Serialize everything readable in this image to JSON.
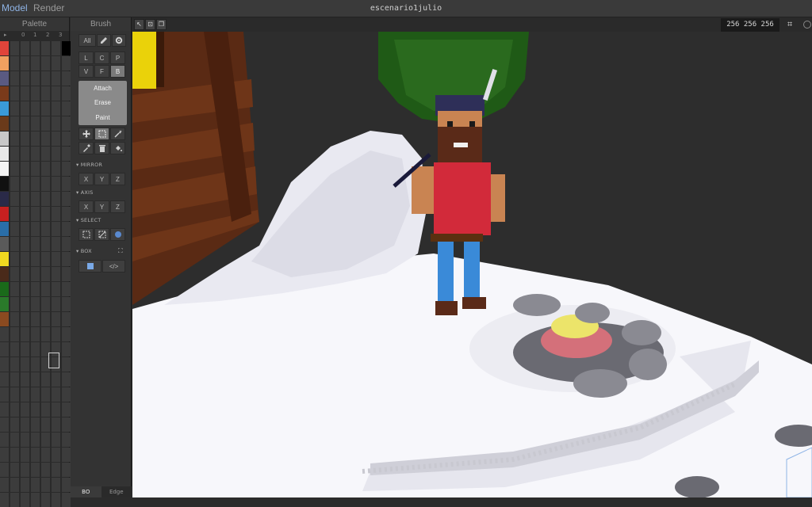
{
  "header": {
    "tabs": [
      {
        "label": "Model"
      },
      {
        "label": "Render"
      }
    ],
    "file_title": "escenario1julio"
  },
  "palette": {
    "title": "Palette",
    "columns": [
      "0",
      "1",
      "2",
      "3"
    ],
    "colors": [
      "#e0443a",
      "#f0a060",
      "#5a5a82",
      "#7a3a1a",
      "#3a9ad8",
      "#6a3a1a",
      "#c8c8c8",
      "#e8e8e8",
      "#f4f4f4",
      "#111111",
      "#2a2a48",
      "#c82020",
      "#2a6ea8",
      "#5a5a5a",
      "#f0d820",
      "#4a2a1a",
      "#1a6a1a",
      "#2a7a2a",
      "#8a4a20"
    ]
  },
  "brush": {
    "title": "Brush",
    "all_label": "All",
    "row1": [
      "L",
      "C",
      "P"
    ],
    "row2": [
      "V",
      "F",
      "B"
    ],
    "modes": [
      "Attach",
      "Erase",
      "Paint"
    ],
    "mirror_label": "MIRROR",
    "axis_label": "AXIS",
    "select_label": "SELECT",
    "box_label": "BOX",
    "xyz": [
      "X",
      "Y",
      "Z"
    ],
    "bottom_tabs": [
      "BO",
      "Edge"
    ]
  },
  "viewport": {
    "dimensions": "256 256 256"
  }
}
